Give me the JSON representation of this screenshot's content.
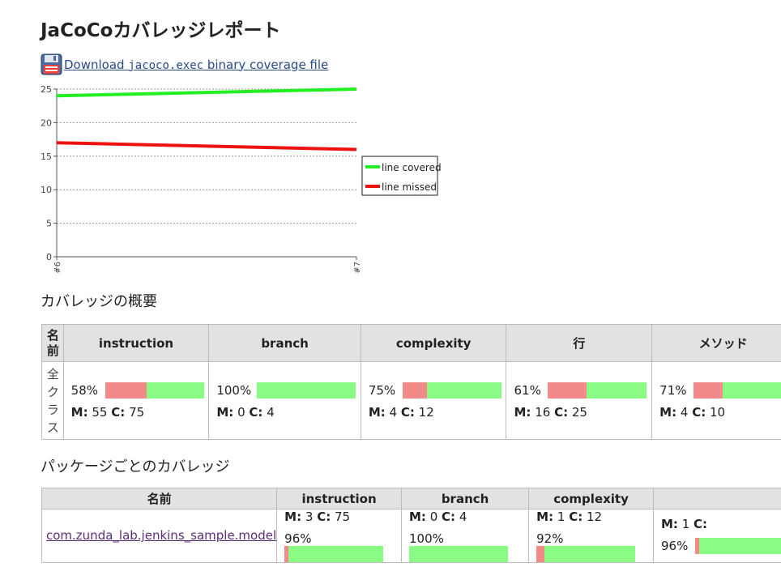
{
  "page": {
    "title": "JaCoCoカバレッジレポート"
  },
  "download": {
    "prefix": "Download ",
    "file": "jacoco.exec",
    "suffix": " binary coverage file"
  },
  "trend": {
    "yticks": [
      "0",
      "5",
      "10",
      "15",
      "20",
      "25"
    ],
    "xticks": [
      "#6",
      "#7"
    ],
    "legend": [
      {
        "label": "line covered",
        "color": "#22ee22"
      },
      {
        "label": "line missed",
        "color": "#ee1111"
      }
    ]
  },
  "chart_data": {
    "type": "line",
    "x": [
      "#6",
      "#7"
    ],
    "series": [
      {
        "name": "line covered",
        "values": [
          24,
          25
        ]
      },
      {
        "name": "line missed",
        "values": [
          17,
          16
        ]
      }
    ],
    "ylim": [
      0,
      25
    ],
    "grid": true,
    "legend_position": "right"
  },
  "summary": {
    "heading": "カバレッジの概要",
    "name_header": "名前",
    "row_label": "全クラス",
    "columns": [
      {
        "header": "instruction",
        "pct": "58%",
        "ratio": 0.58,
        "m": "55",
        "c": "75"
      },
      {
        "header": "branch",
        "pct": "100%",
        "ratio": 1.0,
        "m": "0",
        "c": "4"
      },
      {
        "header": "complexity",
        "pct": "75%",
        "ratio": 0.75,
        "m": "4",
        "c": "12"
      },
      {
        "header": "行",
        "pct": "61%",
        "ratio": 0.61,
        "m": "16",
        "c": "25"
      },
      {
        "header": "メソッド",
        "pct": "71%",
        "ratio": 0.71,
        "m": "4",
        "c": "10"
      }
    ]
  },
  "packages": {
    "heading": "パッケージごとのカバレッジ",
    "name_header": "名前",
    "columns": [
      "instruction",
      "branch",
      "complexity",
      ""
    ],
    "rows": [
      {
        "name": "com.zunda_lab.jenkins_sample.model",
        "cells": [
          {
            "m": "3",
            "c": "75",
            "pct": "96%",
            "ratio": 0.96
          },
          {
            "m": "0",
            "c": "4",
            "pct": "100%",
            "ratio": 1.0
          },
          {
            "m": "1",
            "c": "12",
            "pct": "92%",
            "ratio": 0.92
          },
          {
            "m": "1",
            "c": "",
            "pct": "96%",
            "ratio": 0.96
          }
        ]
      }
    ]
  },
  "labels": {
    "m": "M:",
    "c": "C:"
  }
}
